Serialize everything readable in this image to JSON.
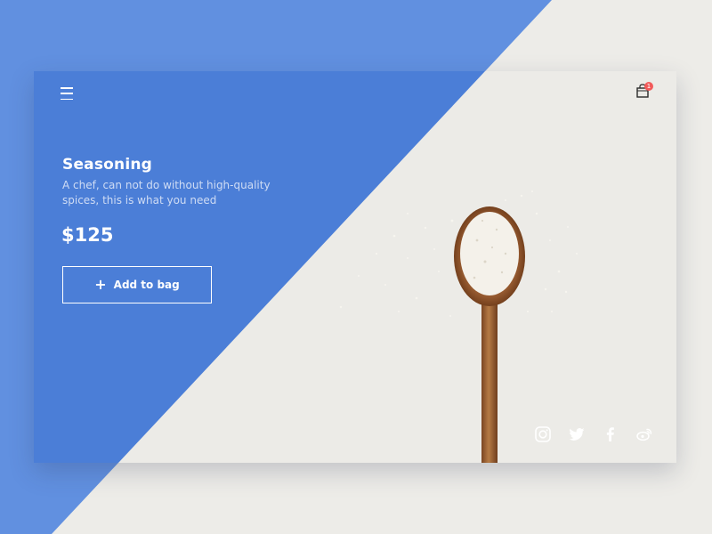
{
  "product": {
    "title": "Seasoning",
    "description": "A chef, can not do without high-quality spices, this is what you need",
    "price": "$125"
  },
  "actions": {
    "add_to_bag_label": "Add to bag"
  },
  "cart": {
    "badge_count": "1"
  },
  "social": [
    "instagram-icon",
    "twitter-icon",
    "facebook-icon",
    "weibo-icon"
  ],
  "colors": {
    "page_blue": "#6190e0",
    "card_blue": "#4b7ed7",
    "background": "#edece8",
    "badge": "#f25b5b",
    "spoon": "#a8683a",
    "rice": "#f4f1ea"
  }
}
